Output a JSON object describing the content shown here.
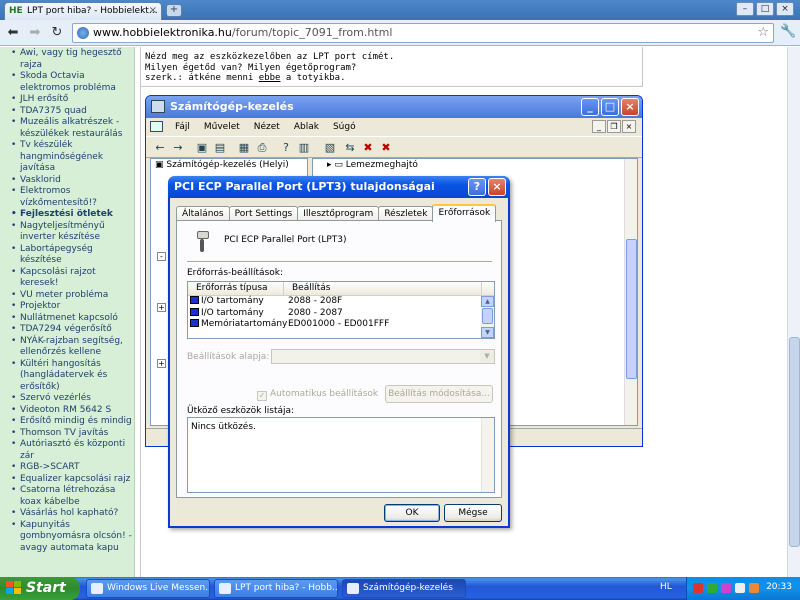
{
  "browser": {
    "tab_title": "LPT port hiba? - Hobbielekt…",
    "tab_favicon": "HE",
    "url_host": "www.hobbielektronika.hu",
    "url_path": "/forum/topic_7091_from.html",
    "icons": [
      "back-icon",
      "forward-icon",
      "reload-icon",
      "globe-icon",
      "star-icon",
      "wrench-icon"
    ]
  },
  "sidebar": {
    "items": [
      {
        "text": "Awi, vagy tig hegesztő rajza",
        "bold": false
      },
      {
        "text": "Skoda Octavia elektromos probléma",
        "bold": false
      },
      {
        "text": "JLH erősítő",
        "bold": false
      },
      {
        "text": "TDA7375 quad",
        "bold": false
      },
      {
        "text": "Muzeális alkatrészek - készülékek restaurálás",
        "bold": false
      },
      {
        "text": "Tv készülék hangminőségének javítása",
        "bold": false
      },
      {
        "text": "Vasklorid",
        "bold": false
      },
      {
        "text": "Elektromos vízkőmentesítő!?",
        "bold": false
      },
      {
        "text": "Fejlesztési ötletek",
        "bold": true
      },
      {
        "text": "Nagyteljesítményű inverter készítése",
        "bold": false
      },
      {
        "text": "Labortápegység készítése",
        "bold": false
      },
      {
        "text": "Kapcsolási rajzot keresek!",
        "bold": false
      },
      {
        "text": "VU meter probléma",
        "bold": false
      },
      {
        "text": "Projektor",
        "bold": false
      },
      {
        "text": "Nullátmenet kapcsoló",
        "bold": false
      },
      {
        "text": "TDA7294 végerősítő",
        "bold": false
      },
      {
        "text": "NYÁK-rajzban segítség, ellenőrzés kellene",
        "bold": false
      },
      {
        "text": "Kültéri hangosítás (hangládatervek és erősítők)",
        "bold": false
      },
      {
        "text": "Szervó vezérlés",
        "bold": false
      },
      {
        "text": "Videoton RM 5642 S",
        "bold": false
      },
      {
        "text": "Erősítő mindig és mindig",
        "bold": false
      },
      {
        "text": "Thomson TV javítás",
        "bold": false
      },
      {
        "text": "Autóriasztó és központi zár",
        "bold": false
      },
      {
        "text": "RGB->SCART",
        "bold": false
      },
      {
        "text": "Equalizer kapcsolási rajz",
        "bold": false
      },
      {
        "text": "Csatorna létrehozása koax kábelbe",
        "bold": false
      },
      {
        "text": "Vásárlás hol kapható?",
        "bold": false
      },
      {
        "text": "Kapunyitás gombnyomásra olcsón! - avagy automata kapu",
        "bold": false
      }
    ]
  },
  "forum": {
    "line1": "Nézd meg az eszközkezelőben az LPT port címét.",
    "line2": "Milyen égetőd van? Milyen égetőprogram?",
    "line3_pre": "szerk.: átkéne menni ",
    "line3_link": "ebbe",
    "line3_post": " a totyikba."
  },
  "mmc": {
    "title": "Számítógép-kezelés",
    "menu": [
      "Fájl",
      "Művelet",
      "Nézet",
      "Ablak",
      "Súgó"
    ],
    "tree_root": "Számítógép-kezelés (Helyi)",
    "right_item": "Lemezmeghajtó"
  },
  "dialog": {
    "title": "PCI ECP Parallel Port (LPT3) tulajdonságai",
    "tabs": [
      "Általános",
      "Port Settings",
      "Illesztőprogram",
      "Részletek",
      "Erőforrások"
    ],
    "active_tab": "Erőforrások",
    "device_name": "PCI ECP Parallel Port (LPT3)",
    "resource_settings_label": "Erőforrás-beállítások:",
    "columns": [
      "Erőforrás típusa",
      "Beállítás"
    ],
    "resources": [
      {
        "type": "I/O tartomány",
        "setting": "2088 - 208F"
      },
      {
        "type": "I/O tartomány",
        "setting": "2080 - 2087"
      },
      {
        "type": "Memóriatartomány",
        "setting": "ED001000 - ED001FFF"
      }
    ],
    "settings_based_on_label": "Beállítások alapja:",
    "auto_settings_label": "Automatikus beállítások",
    "change_settings_button": "Beállítás módosítása...",
    "conflict_label": "Ütköző eszközök listája:",
    "conflict_text": "Nincs ütközés.",
    "ok_button": "OK",
    "cancel_button": "Mégse"
  },
  "taskbar": {
    "start_label": "Start",
    "tasks": [
      {
        "label": "Windows Live Messen...",
        "active": false
      },
      {
        "label": "LPT port hiba? - Hobb...",
        "active": false
      },
      {
        "label": "Számítógép-kezelés",
        "active": true
      }
    ],
    "language": "HL",
    "clock": "20:33"
  }
}
